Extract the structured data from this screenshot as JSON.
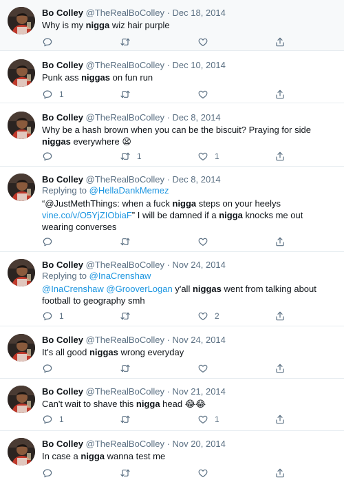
{
  "colors": {
    "accent": "#1b95e0",
    "muted": "#5b7083",
    "border": "#e6ecf0"
  },
  "icons": {
    "reply": "reply-icon",
    "retweet": "retweet-icon",
    "like": "like-icon",
    "share": "share-icon"
  },
  "tweets": [
    {
      "name": "Bo Colley",
      "handle": "@TheRealBoColley",
      "separator": "·",
      "date": "Dec 18, 2014",
      "body": [
        {
          "t": "Why is my "
        },
        {
          "t": "nigga",
          "b": true
        },
        {
          "t": " wiz hair purple"
        }
      ],
      "replies": "",
      "retweets": "",
      "likes": ""
    },
    {
      "name": "Bo Colley",
      "handle": "@TheRealBoColley",
      "separator": "·",
      "date": "Dec 10, 2014",
      "body": [
        {
          "t": "Punk ass "
        },
        {
          "t": "niggas",
          "b": true
        },
        {
          "t": " on fun run"
        }
      ],
      "replies": "1",
      "retweets": "",
      "likes": ""
    },
    {
      "name": "Bo Colley",
      "handle": "@TheRealBoColley",
      "separator": "·",
      "date": "Dec 8, 2014",
      "body": [
        {
          "t": "Why be a hash brown when you can be the biscuit? Praying for side "
        },
        {
          "t": "niggas",
          "b": true
        },
        {
          "t": " everywhere "
        },
        {
          "t": "😫",
          "e": true
        }
      ],
      "replies": "",
      "retweets": "1",
      "likes": "1"
    },
    {
      "name": "Bo Colley",
      "handle": "@TheRealBoColley",
      "separator": "·",
      "date": "Dec 8, 2014",
      "reply_prefix": "Replying to ",
      "reply_to": "@HellaDankMemez",
      "body": [
        {
          "t": "“@JustMethThings: when a fuck "
        },
        {
          "t": "nigga",
          "b": true
        },
        {
          "t": " steps on your heelys "
        },
        {
          "t": "vine.co/v/O5YjZIObiaF",
          "l": true
        },
        {
          "t": "” I will be damned if a "
        },
        {
          "t": "nigga",
          "b": true
        },
        {
          "t": " knocks me out wearing converses"
        }
      ],
      "replies": "",
      "retweets": "",
      "likes": ""
    },
    {
      "name": "Bo Colley",
      "handle": "@TheRealBoColley",
      "separator": "·",
      "date": "Nov 24, 2014",
      "reply_prefix": "Replying to ",
      "reply_to": "@InaCrenshaw",
      "body": [
        {
          "t": "@InaCrenshaw",
          "l": true
        },
        {
          "t": " "
        },
        {
          "t": "@GrooverLogan",
          "l": true
        },
        {
          "t": " y'all "
        },
        {
          "t": "niggas",
          "b": true
        },
        {
          "t": " went from talking about football to geography smh"
        }
      ],
      "replies": "1",
      "retweets": "",
      "likes": "2"
    },
    {
      "name": "Bo Colley",
      "handle": "@TheRealBoColley",
      "separator": "·",
      "date": "Nov 24, 2014",
      "body": [
        {
          "t": "It's all good "
        },
        {
          "t": "niggas",
          "b": true
        },
        {
          "t": " wrong everyday"
        }
      ],
      "replies": "",
      "retweets": "",
      "likes": ""
    },
    {
      "name": "Bo Colley",
      "handle": "@TheRealBoColley",
      "separator": "·",
      "date": "Nov 21, 2014",
      "body": [
        {
          "t": "Can't wait to shave this "
        },
        {
          "t": "nigga",
          "b": true
        },
        {
          "t": " head "
        },
        {
          "t": "😂😂",
          "e": true
        }
      ],
      "replies": "1",
      "retweets": "",
      "likes": "1"
    },
    {
      "name": "Bo Colley",
      "handle": "@TheRealBoColley",
      "separator": "·",
      "date": "Nov 20, 2014",
      "body": [
        {
          "t": "In case a "
        },
        {
          "t": "nigga",
          "b": true
        },
        {
          "t": " wanna test me"
        }
      ],
      "replies": "",
      "retweets": "",
      "likes": ""
    }
  ]
}
